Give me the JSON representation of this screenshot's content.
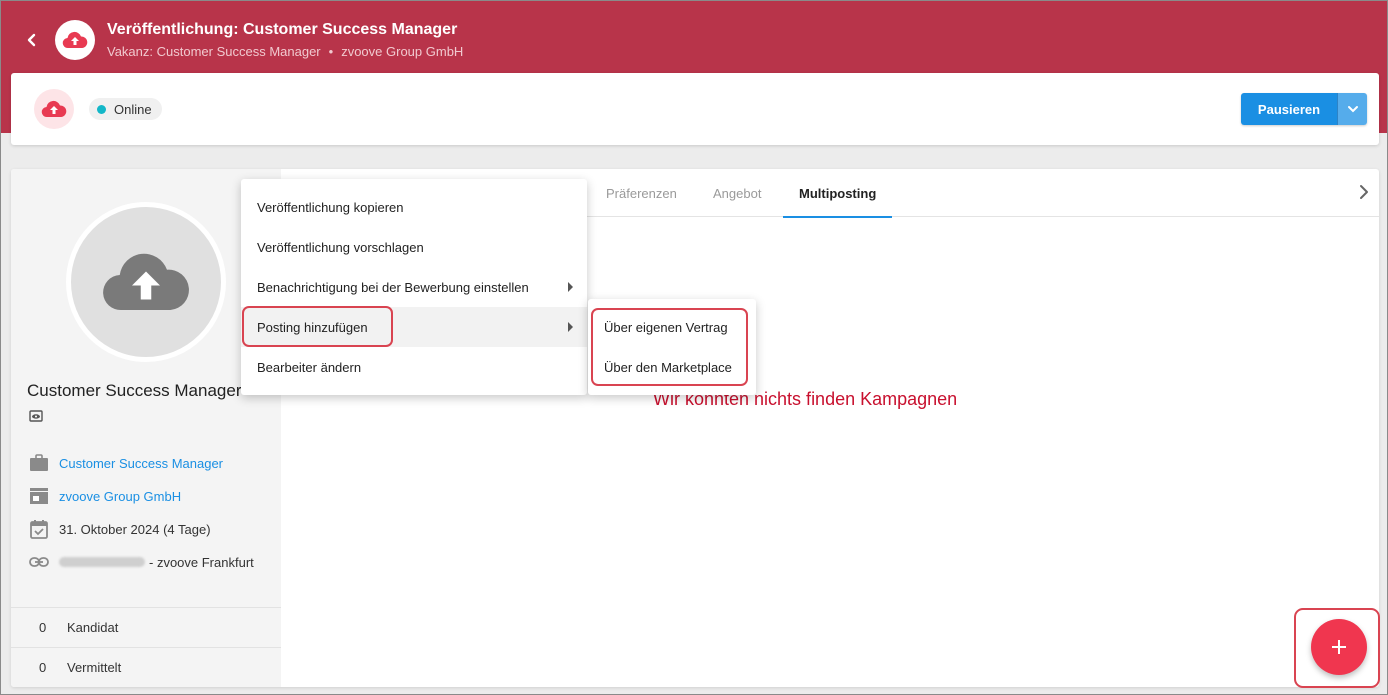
{
  "header": {
    "title": "Veröffentlichung: Customer Success Manager",
    "vacancy": "Vakanz: Customer Success Manager",
    "separator": "•",
    "company": "zvoove Group GmbH",
    "color": "#b8344a"
  },
  "status": {
    "label": "Online",
    "indicator_color": "#13b7c8",
    "pause_button": "Pausieren",
    "button_color": "#1a8fe3"
  },
  "profile": {
    "title": "Customer Success Manager",
    "vacancy_link": "Customer Success Manager",
    "company_link": "zvoove Group GmbH",
    "date": "31. Oktober 2024 (4 Tage)",
    "location_suffix": "- zvoove Frankfurt"
  },
  "stats": [
    {
      "value": "0",
      "label": "Kandidat"
    },
    {
      "value": "0",
      "label": "Vermittelt"
    }
  ],
  "tabs": [
    {
      "label": "Präferenzen"
    },
    {
      "label": "Angebot"
    },
    {
      "label": "Multiposting",
      "active": true
    }
  ],
  "empty_message": "Wir konnten nichts finden Kampagnen",
  "context_menu": [
    {
      "label": "Veröffentlichung kopieren"
    },
    {
      "label": "Veröffentlichung vorschlagen"
    },
    {
      "label": "Benachrichtigung bei der Bewerbung einstellen",
      "submenu": true
    },
    {
      "label": "Posting hinzufügen",
      "submenu": true,
      "hover": true
    },
    {
      "label": "Bearbeiter ändern"
    }
  ],
  "submenu": [
    {
      "label": "Über eigenen Vertrag"
    },
    {
      "label": "Über den Marketplace"
    }
  ],
  "icons": {
    "back": "chevron-left-icon",
    "upload": "cloud-upload-icon",
    "fab": "plus-icon"
  },
  "accent_colors": {
    "fab": "#f0364f",
    "highlight": "#d94451",
    "error_text": "#c8102e"
  }
}
